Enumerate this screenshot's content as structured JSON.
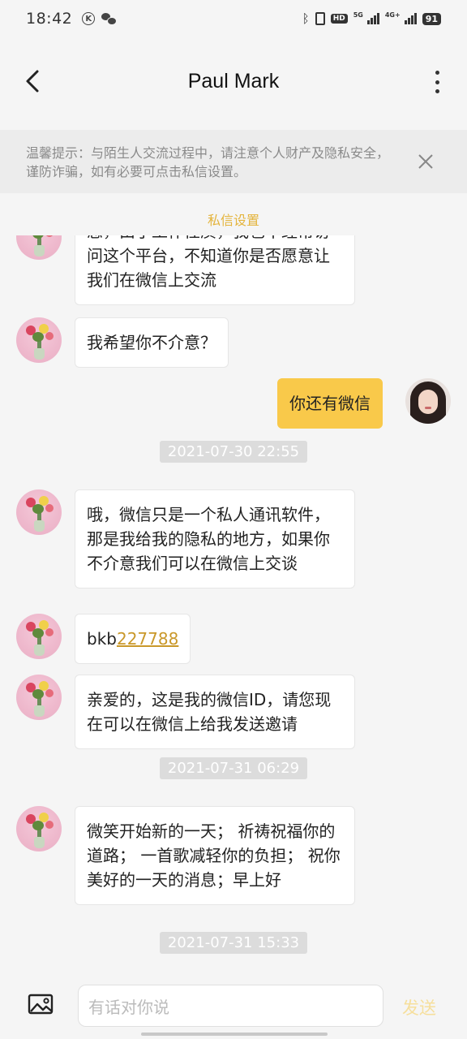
{
  "status_bar": {
    "time": "18:42",
    "battery": "91",
    "network_5g": "5G",
    "network_4g": "4G+",
    "hd": "HD"
  },
  "header": {
    "title": "Paul Mark"
  },
  "notice": {
    "text": "温馨提示：与陌生人交流过程中，请注意个人财产及隐私安全，谨防诈骗，如有必要可点击私信设置。"
  },
  "privacy_link": "私信设置",
  "messages": [
    {
      "from": "other",
      "text": "您，由于工作性质，我也不经常访问这个平台，不知道你是否愿意让我们在微信上交流"
    },
    {
      "from": "other",
      "text": "我希望你不介意？"
    },
    {
      "from": "me",
      "text": "你还有微信"
    },
    {
      "type": "time",
      "text": "2021-07-30 22:55"
    },
    {
      "from": "other",
      "text": "哦，微信只是一个私人通讯软件，那是我给我的隐私的地方，如果你不介意我们可以在微信上交谈"
    },
    {
      "from": "other",
      "text_prefix": "bkb",
      "text_link": "227788"
    },
    {
      "from": "other",
      "text": "亲爱的，这是我的微信ID，请您现在可以在微信上给我发送邀请"
    },
    {
      "type": "time",
      "text": "2021-07-31 06:29"
    },
    {
      "from": "other",
      "text": "微笑开始新的一天； 祈祷祝福你的道路； 一首歌减轻你的负担； 祝你美好的一天的消息；早上好"
    },
    {
      "type": "time",
      "text": "2021-07-31 15:33"
    }
  ],
  "input": {
    "placeholder": "有话对你说",
    "send_label": "发送"
  },
  "colors": {
    "accent": "#f9c94a",
    "link": "#c9982a",
    "privacy_link": "#e4b43c"
  }
}
